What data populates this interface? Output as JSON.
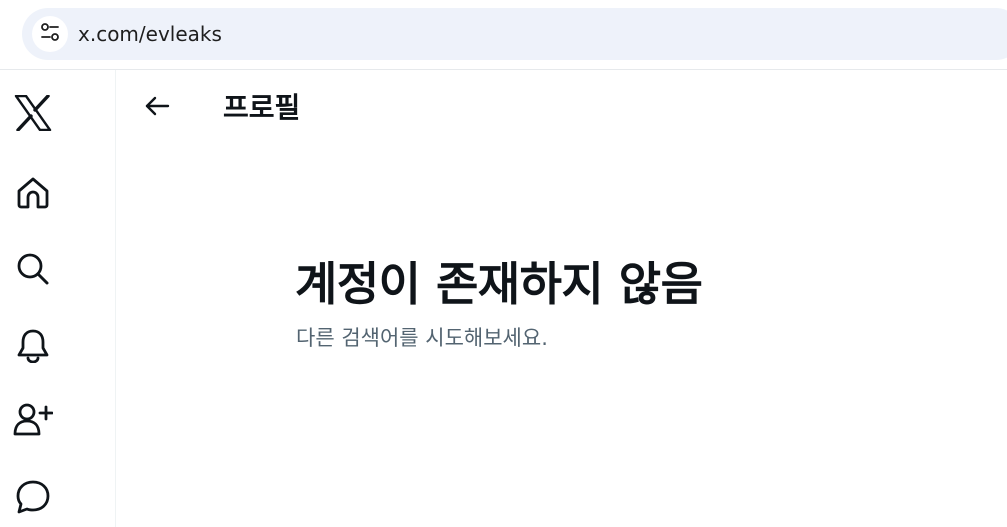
{
  "browser": {
    "url": "x.com/evleaks"
  },
  "nav": {
    "items": [
      {
        "icon": "x-logo-icon"
      },
      {
        "icon": "home-icon"
      },
      {
        "icon": "search-icon"
      },
      {
        "icon": "bell-icon"
      },
      {
        "icon": "person-add-icon"
      },
      {
        "icon": "chat-bubble-icon"
      }
    ]
  },
  "header": {
    "title": "프로필"
  },
  "empty_state": {
    "title": "계정이 존재하지 않음",
    "subtitle": "다른 검색어를 시도해보세요."
  },
  "colors": {
    "text_primary": "#0f1419",
    "text_secondary": "#536471",
    "address_bar_bg": "#eef2fa"
  }
}
